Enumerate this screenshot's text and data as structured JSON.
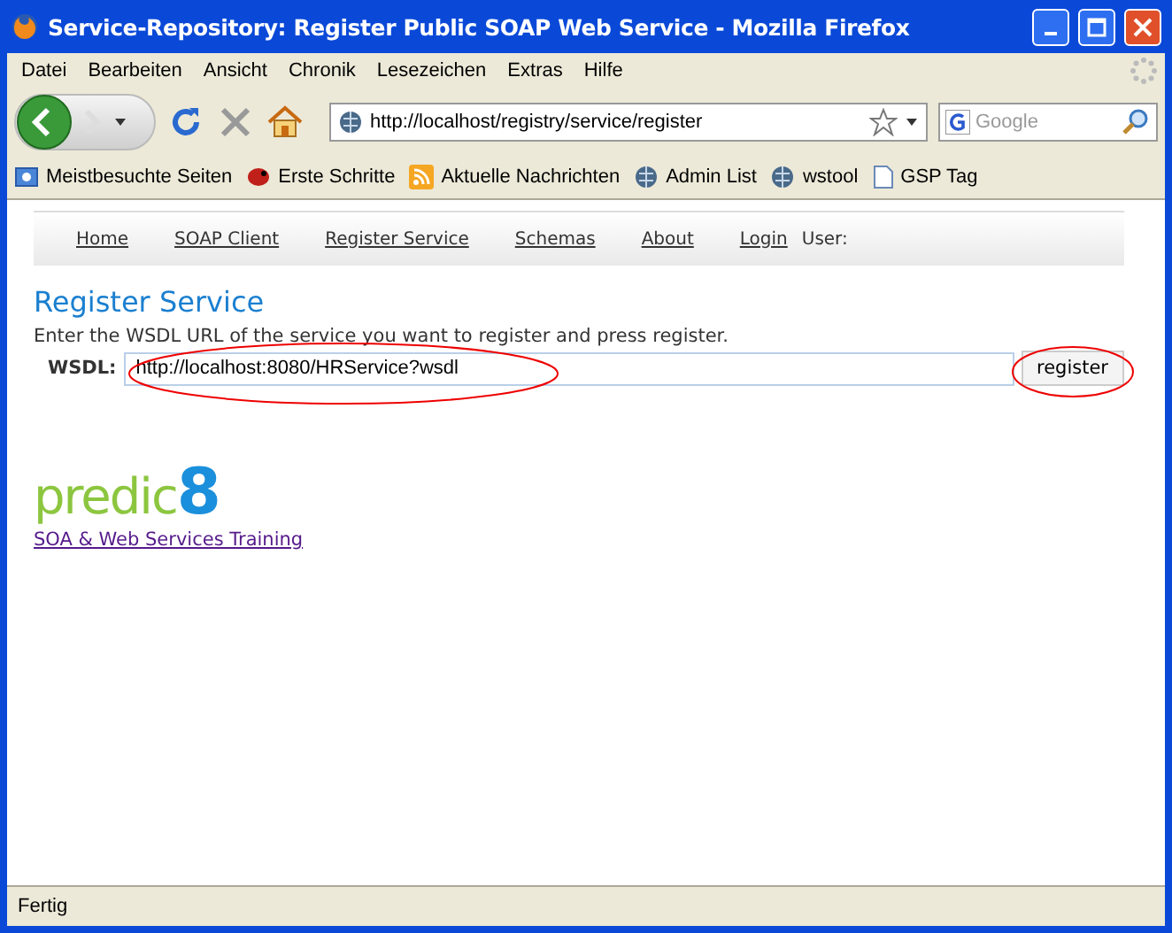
{
  "window": {
    "title": "Service-Repository: Register Public SOAP Web Service - Mozilla Firefox"
  },
  "menu": [
    "Datei",
    "Bearbeiten",
    "Ansicht",
    "Chronik",
    "Lesezeichen",
    "Extras",
    "Hilfe"
  ],
  "address": {
    "value": "http://localhost/registry/service/register"
  },
  "search": {
    "placeholder": "Google"
  },
  "bookmarks": [
    {
      "label": "Meistbesuchte Seiten",
      "kind": "folder"
    },
    {
      "label": "Erste Schritte",
      "kind": "bug"
    },
    {
      "label": "Aktuelle Nachrichten",
      "kind": "feed"
    },
    {
      "label": "Admin List",
      "kind": "site"
    },
    {
      "label": "wstool",
      "kind": "site"
    },
    {
      "label": "GSP Tag",
      "kind": "page"
    }
  ],
  "nav": {
    "links": [
      "Home",
      "SOAP Client",
      "Register Service",
      "Schemas",
      "About",
      "Login"
    ],
    "user_label": "User:"
  },
  "heading": "Register Service",
  "instructions": "Enter the WSDL URL of the service you want to register and press register.",
  "form": {
    "label": "WSDL:",
    "value": "http://localhost:8080/HRService?wsdl",
    "button": "register"
  },
  "logo": {
    "word": "predic",
    "digit": "8"
  },
  "training_link": "SOA & Web Services Training",
  "status_bar": "Fertig"
}
